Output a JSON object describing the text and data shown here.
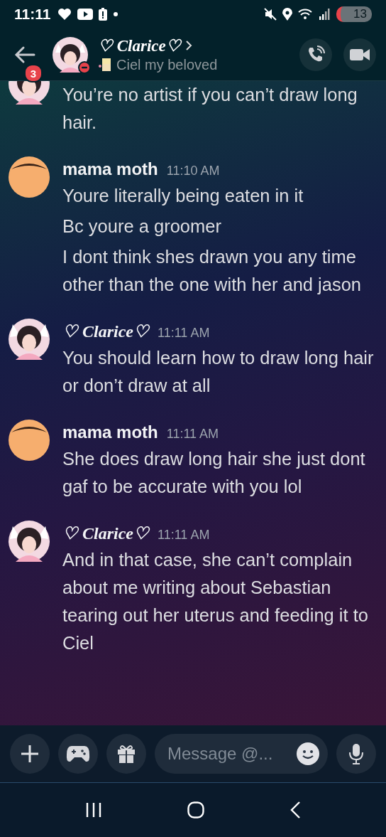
{
  "status_bar": {
    "time": "11:11",
    "battery": "13"
  },
  "header": {
    "badge": "3",
    "name": "♡ Clarice♡",
    "status": "Ciel my beloved"
  },
  "messages": [
    {
      "kind": "picture",
      "lines": [
        "You’re no artist if you can’t draw long hair."
      ]
    },
    {
      "kind": "plain",
      "author": "mama moth",
      "time": "11:10 AM",
      "lines": [
        "Youre literally being eaten in it",
        "Bc youre a groomer",
        "I dont think shes drawn you any time other than the one with her and jason"
      ]
    },
    {
      "kind": "picture",
      "author": "♡ Clarice♡",
      "time": "11:11 AM",
      "lines": [
        "You should learn how to draw long hair or don’t draw at all"
      ]
    },
    {
      "kind": "plain",
      "author": "mama moth",
      "time": "11:11 AM",
      "lines": [
        "She does draw long hair she just dont gaf to be accurate with you lol"
      ]
    },
    {
      "kind": "picture",
      "author": "♡ Clarice♡",
      "time": "11:11 AM",
      "lines": [
        "And in that case, she can’t complain about me writing about Sebastian tearing out her uterus and feeding it to Ciel"
      ]
    }
  ],
  "composer": {
    "placeholder": "Message @..."
  }
}
